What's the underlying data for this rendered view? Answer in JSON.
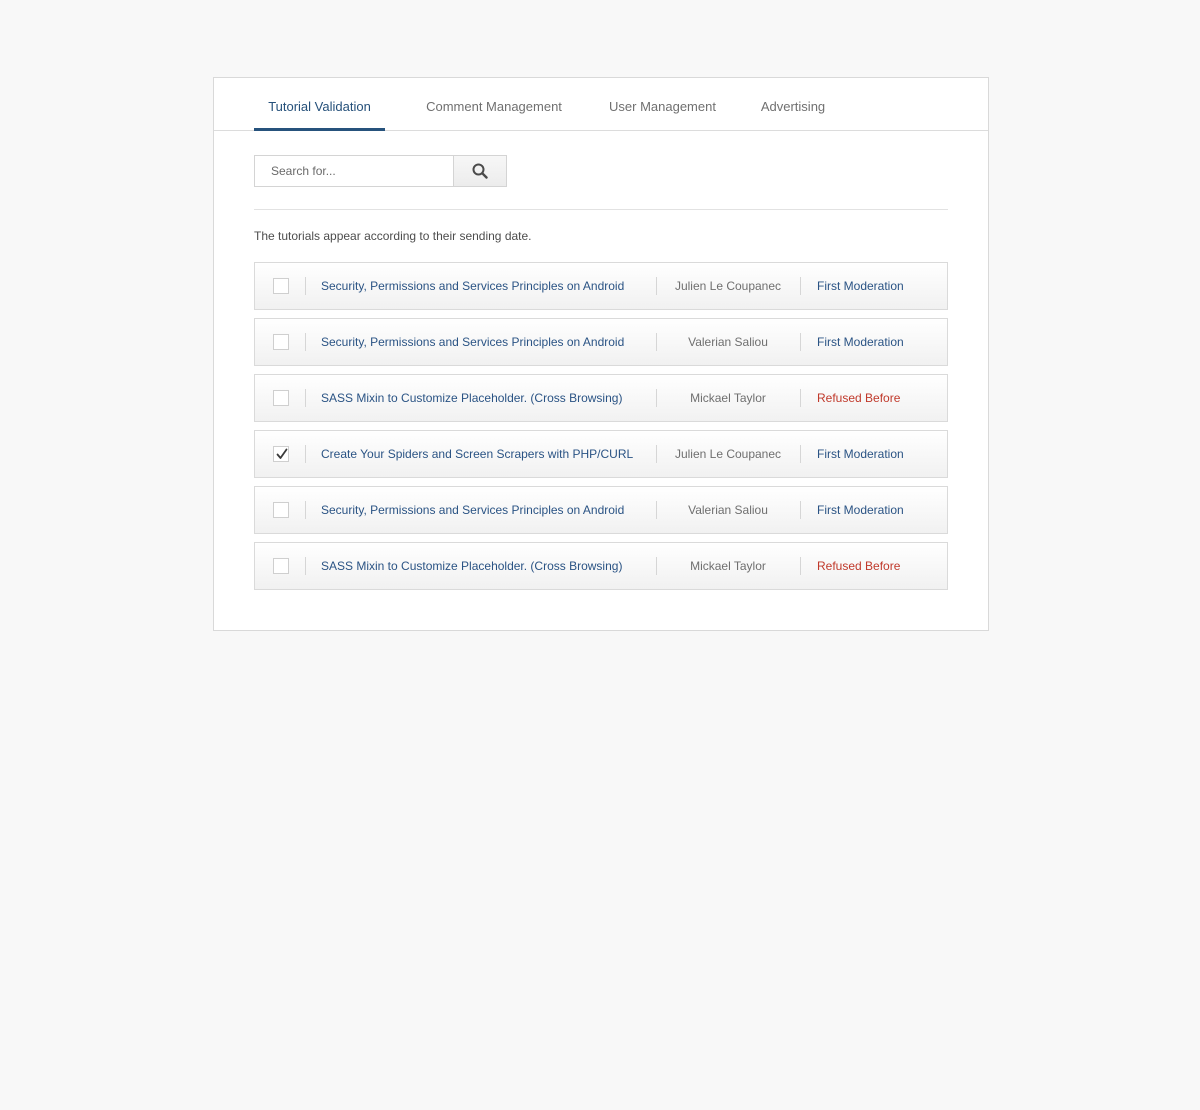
{
  "tabs": [
    {
      "label": "Tutorial Validation",
      "active": true
    },
    {
      "label": "Comment Management",
      "active": false
    },
    {
      "label": "User Management",
      "active": false
    },
    {
      "label": "Advertising",
      "active": false
    }
  ],
  "search": {
    "placeholder": "Search for...",
    "value": "",
    "button_icon": "search-icon"
  },
  "info_text": "The tutorials appear according to their sending date.",
  "colors": {
    "accent": "#26527c",
    "link": "#2a5384",
    "refused": "#c0392b",
    "background": "#f8f8f8"
  },
  "tutorials": [
    {
      "checked": false,
      "title": "Security, Permissions and Services Principles on Android",
      "author": "Julien Le Coupanec",
      "status": "First Moderation",
      "status_type": "first"
    },
    {
      "checked": false,
      "title": "Security, Permissions and Services Principles on Android",
      "author": "Valerian Saliou",
      "status": "First Moderation",
      "status_type": "first"
    },
    {
      "checked": false,
      "title": "SASS Mixin to Customize Placeholder. (Cross Browsing)",
      "author": "Mickael Taylor",
      "status": "Refused Before",
      "status_type": "refused"
    },
    {
      "checked": true,
      "title": "Create Your Spiders and Screen Scrapers with PHP/CURL",
      "author": "Julien Le Coupanec",
      "status": "First Moderation",
      "status_type": "first"
    },
    {
      "checked": false,
      "title": "Security, Permissions and Services Principles on Android",
      "author": "Valerian Saliou",
      "status": "First Moderation",
      "status_type": "first"
    },
    {
      "checked": false,
      "title": "SASS Mixin to Customize Placeholder. (Cross Browsing)",
      "author": "Mickael Taylor",
      "status": "Refused Before",
      "status_type": "refused"
    }
  ]
}
